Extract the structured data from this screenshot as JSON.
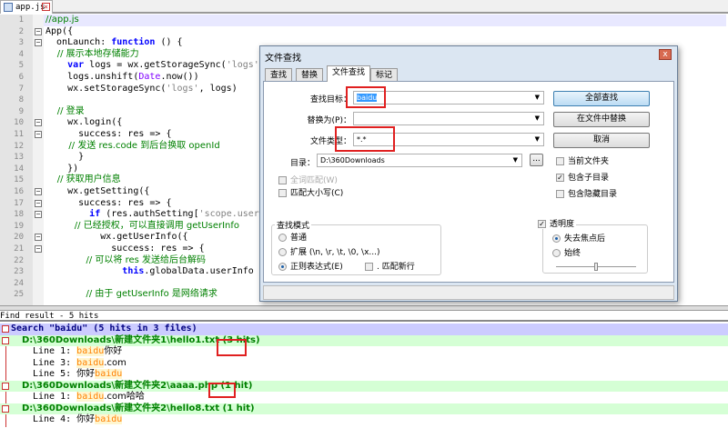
{
  "tab": {
    "label": "app.js"
  },
  "editor": {
    "line_numbers": [
      "1",
      "2",
      "3",
      "4",
      "5",
      "6",
      "7",
      "8",
      "9",
      "10",
      "11",
      "12",
      "13",
      "14",
      "15",
      "16",
      "17",
      "18",
      "19",
      "20",
      "21",
      "22",
      "23",
      "24",
      "25"
    ],
    "fold_lines": [
      2,
      3,
      10,
      11,
      16,
      17,
      18,
      20,
      21
    ],
    "lines": [
      [
        {
          "t": "//app.js",
          "k": "comment"
        }
      ],
      [
        {
          "t": "App({",
          "k": "plain"
        }
      ],
      [
        {
          "t": "  onLaunch: ",
          "k": "plain"
        },
        {
          "t": "function",
          "k": "keyword"
        },
        {
          "t": " () {",
          "k": "plain"
        }
      ],
      [
        {
          "t": "    // 展示本地存储能力",
          "k": "comment"
        }
      ],
      [
        {
          "t": "    ",
          "k": "plain"
        },
        {
          "t": "var",
          "k": "keyword"
        },
        {
          "t": " logs = wx.getStorageSync(",
          "k": "plain"
        },
        {
          "t": "'logs'",
          "k": "string"
        }
      ],
      [
        {
          "t": "    logs.unshift(",
          "k": "plain"
        },
        {
          "t": "Date",
          "k": "builtin"
        },
        {
          "t": ".now())",
          "k": "plain"
        }
      ],
      [
        {
          "t": "    wx.setStorageSync(",
          "k": "plain"
        },
        {
          "t": "'logs'",
          "k": "string"
        },
        {
          "t": ", logs)",
          "k": "plain"
        }
      ],
      [
        {
          "t": "",
          "k": "plain"
        }
      ],
      [
        {
          "t": "    // 登录",
          "k": "comment"
        }
      ],
      [
        {
          "t": "    wx.login({",
          "k": "plain"
        }
      ],
      [
        {
          "t": "      success: res => {",
          "k": "plain"
        }
      ],
      [
        {
          "t": "        // 发送 res.code 到后台换取 openId",
          "k": "comment"
        }
      ],
      [
        {
          "t": "      }",
          "k": "plain"
        }
      ],
      [
        {
          "t": "    })",
          "k": "plain"
        }
      ],
      [
        {
          "t": "    // 获取用户信息",
          "k": "comment"
        }
      ],
      [
        {
          "t": "    wx.getSetting({",
          "k": "plain"
        }
      ],
      [
        {
          "t": "      success: res => {",
          "k": "plain"
        }
      ],
      [
        {
          "t": "        ",
          "k": "plain"
        },
        {
          "t": "if",
          "k": "keyword"
        },
        {
          "t": " (res.authSetting[",
          "k": "plain"
        },
        {
          "t": "'scope.userInfo'",
          "k": "string"
        }
      ],
      [
        {
          "t": "          // 已经授权，可以直接调用 getUserInfo",
          "k": "comment"
        }
      ],
      [
        {
          "t": "          wx.getUserInfo({",
          "k": "plain"
        }
      ],
      [
        {
          "t": "            success: res => {",
          "k": "plain"
        }
      ],
      [
        {
          "t": "              // 可以将 res 发送给后台解码",
          "k": "comment"
        }
      ],
      [
        {
          "t": "              ",
          "k": "plain"
        },
        {
          "t": "this",
          "k": "keyword"
        },
        {
          "t": ".globalData.userInfo",
          "k": "plain"
        }
      ],
      [
        {
          "t": "",
          "k": "plain"
        }
      ],
      [
        {
          "t": "              // 由于 getUserInfo 是网络请求",
          "k": "comment"
        }
      ]
    ]
  },
  "find_result": {
    "header": "Find result - 5 hits",
    "search_line": "Search \"baidu\" (5 hits in 3 files)",
    "files": [
      {
        "path": "D:\\360Downloads\\新建文件夹1\\hello1.txt (3 hits)",
        "hits": [
          {
            "prefix": "Line 1: ",
            "pre": "",
            "match": "baidu",
            "post": "你好"
          },
          {
            "prefix": "Line 3: ",
            "pre": "",
            "match": "baidu",
            "post": ".com"
          },
          {
            "prefix": "Line 5: ",
            "pre": "你好",
            "match": "baidu",
            "post": ""
          }
        ]
      },
      {
        "path": "D:\\360Downloads\\新建文件夹2\\aaaa.php (1 hit)",
        "hits": [
          {
            "prefix": "Line 1: ",
            "pre": "",
            "match": "baidu",
            "post": ".com哈哈"
          }
        ]
      },
      {
        "path": "D:\\360Downloads\\新建文件夹2\\hello8.txt (1 hit)",
        "hits": [
          {
            "prefix": "Line 4: ",
            "pre": "你好",
            "match": "baidu",
            "post": ""
          }
        ]
      }
    ]
  },
  "dialog": {
    "title": "文件查找",
    "close": "x",
    "tabs": [
      "查找",
      "替换",
      "文件查找",
      "标记"
    ],
    "find_label": "查找目标：",
    "find_value": "baidu",
    "replace_label": "替换为(P)：",
    "replace_value": "",
    "type_label": "文件类型：",
    "type_value": "*.*",
    "dir_label": "目录：",
    "dir_value": "D:\\360Downloads",
    "browse": "...",
    "whole_word": "全词匹配(W)",
    "match_case": "匹配大小写(C)",
    "btn_find_all": "全部查找",
    "btn_replace_in_files": "在文件中替换",
    "btn_cancel": "取消",
    "current_folder": "当前文件夹",
    "include_sub": "包含子目录",
    "include_hidden": "包含隐藏目录",
    "mode_title": "查找模式",
    "mode_normal": "普通",
    "mode_extended": "扩展 (\\n, \\r, \\t, \\0, \\x...)",
    "mode_regex": "正则表达式(E)",
    "dot_newline": ". 匹配新行",
    "transparency": "透明度",
    "on_lose_focus": "失去焦点后",
    "always": "始终",
    "transparency_level": 0.5
  }
}
